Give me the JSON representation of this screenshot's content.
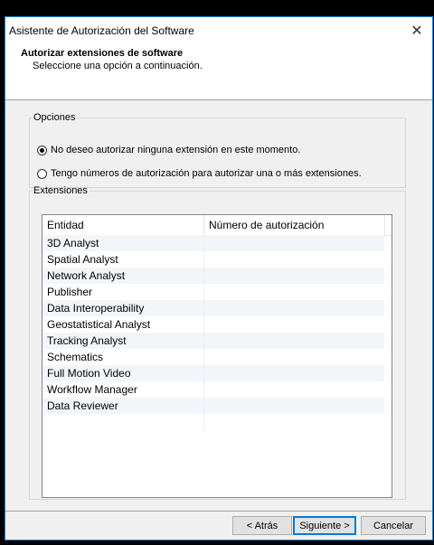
{
  "window": {
    "title": "Asistente de Autorización del Software",
    "close_glyph": "✕"
  },
  "header": {
    "title": "Autorizar extensiones de software",
    "subtitle": "Seleccione una opción a continuación."
  },
  "options": {
    "legend": "Opciones",
    "radios": [
      {
        "label": "No deseo autorizar ninguna extensión en este momento.",
        "checked": true
      },
      {
        "label": "Tengo números de autorización para autorizar una o más extensiones.",
        "checked": false
      }
    ]
  },
  "extensions": {
    "legend": "Extensiones",
    "columns": [
      "Entidad",
      "Número de autorización"
    ],
    "rows": [
      {
        "entity": "3D Analyst",
        "number": ""
      },
      {
        "entity": "Spatial Analyst",
        "number": ""
      },
      {
        "entity": "Network Analyst",
        "number": ""
      },
      {
        "entity": "Publisher",
        "number": ""
      },
      {
        "entity": "Data Interoperability",
        "number": ""
      },
      {
        "entity": "Geostatistical Analyst",
        "number": ""
      },
      {
        "entity": "Tracking Analyst",
        "number": ""
      },
      {
        "entity": "Schematics",
        "number": ""
      },
      {
        "entity": "Full Motion Video",
        "number": ""
      },
      {
        "entity": "Workflow Manager",
        "number": ""
      },
      {
        "entity": "Data Reviewer",
        "number": ""
      },
      {
        "entity": "",
        "number": ""
      }
    ]
  },
  "buttons": {
    "back": "< Atrás",
    "next": "Siguiente >",
    "cancel": "Cancelar"
  }
}
